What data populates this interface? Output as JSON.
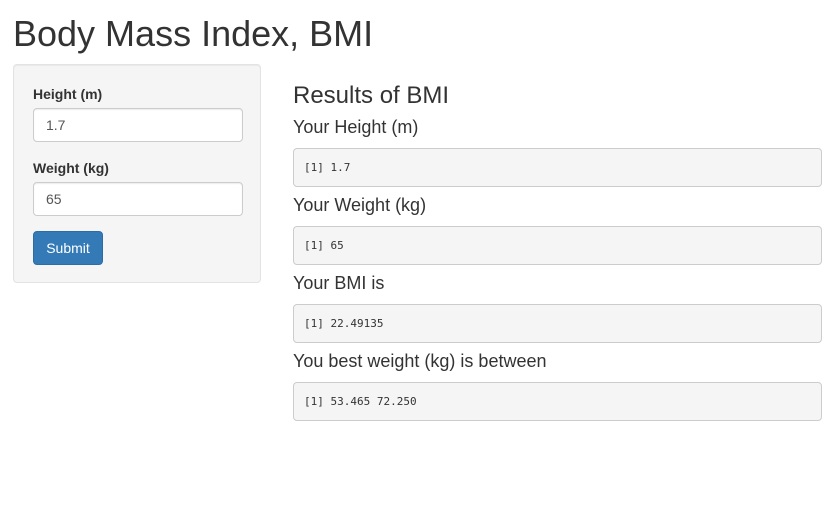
{
  "page": {
    "title": "Body Mass Index, BMI"
  },
  "sidebar": {
    "height_label": "Height (m)",
    "height_value": "1.7",
    "weight_label": "Weight (kg)",
    "weight_value": "65",
    "submit_label": "Submit"
  },
  "main": {
    "results_title": "Results of BMI",
    "height_label": "Your Height (m)",
    "height_output": "[1] 1.7",
    "weight_label": "Your Weight (kg)",
    "weight_output": "[1] 65",
    "bmi_label": "Your BMI is",
    "bmi_output": "[1] 22.49135",
    "best_weight_label": "You best weight (kg) is between",
    "best_weight_output": "[1] 53.465 72.250"
  },
  "colors": {
    "primary_button": "#337ab7",
    "well_background": "#f5f5f5",
    "text": "#333333"
  }
}
